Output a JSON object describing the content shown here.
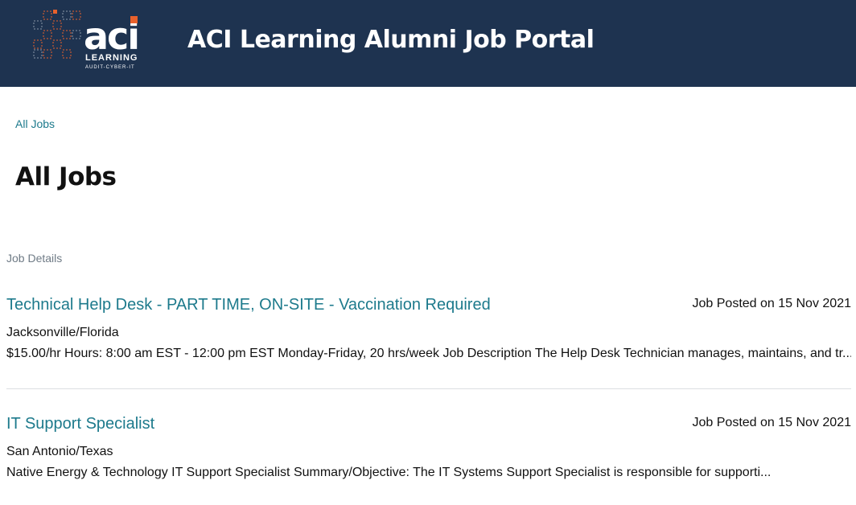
{
  "header": {
    "logo": {
      "wordmark": "aci",
      "subtitle": "LEARNING",
      "tagline": "AUDIT-CYBER-IT"
    },
    "site_title": "ACI Learning Alumni Job Portal",
    "background_color": "#1e3350",
    "accent_color": "#e8612c"
  },
  "breadcrumb": {
    "label": "All Jobs"
  },
  "page_title": "All Jobs",
  "section_label": "Job Details",
  "link_color": "#1d7a8c",
  "jobs": [
    {
      "title": "Technical Help Desk - PART TIME, ON-SITE - Vaccination Required",
      "posted": "Job Posted on 15 Nov 2021",
      "location": "Jacksonville/Florida",
      "description": "$15.00/hr Hours: 8:00 am EST - 12:00 pm EST Monday-Friday, 20 hrs/week Job Description The Help Desk Technician manages, maintains, and tr..."
    },
    {
      "title": "IT Support Specialist",
      "posted": "Job Posted on 15 Nov 2021",
      "location": "San Antonio/Texas",
      "description": "Native Energy & Technology IT Support Specialist Summary/Objective: The IT Systems Support Specialist   is responsible for supporti..."
    }
  ]
}
